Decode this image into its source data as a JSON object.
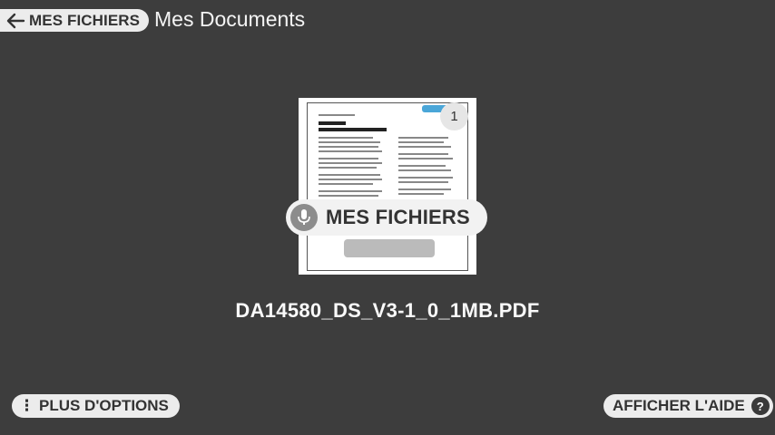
{
  "header": {
    "back_label": "MES FICHIERS",
    "title": "Mes Documents"
  },
  "file": {
    "page_count": "1",
    "name": "DA14580_DS_V3-1_0_1MB.PDF"
  },
  "voice_hint": {
    "label": "MES FICHIERS",
    "icon": "microphone-icon"
  },
  "footer": {
    "more_options_label": "PLUS D'OPTIONS",
    "help_label": "AFFICHER L'AIDE",
    "help_icon_glyph": "?"
  },
  "colors": {
    "background": "#3d3d3d",
    "pill": "#ececec",
    "text_dark": "#333333"
  }
}
